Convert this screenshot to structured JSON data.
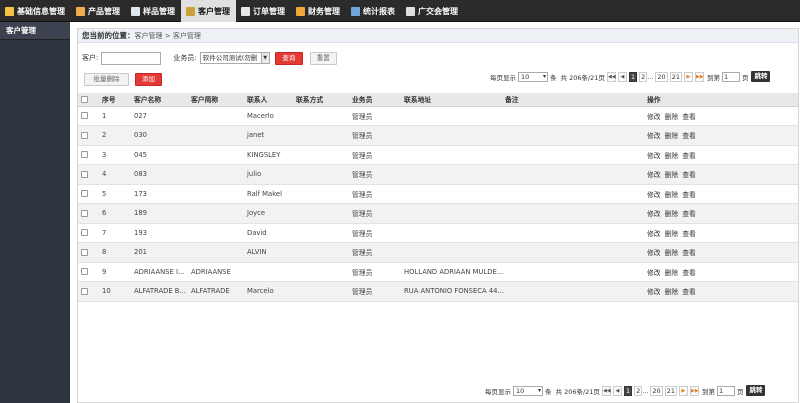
{
  "nav": {
    "items": [
      {
        "label": "基础信息管理",
        "icon": "notebook-icon",
        "color": "#f5c242",
        "active": false
      },
      {
        "label": "产品管理",
        "icon": "box-icon",
        "color": "#f0ad4e",
        "active": false
      },
      {
        "label": "样品管理",
        "icon": "document-icon",
        "color": "#dfe6ee",
        "active": false
      },
      {
        "label": "客户管理",
        "icon": "users-icon",
        "color": "#c9a23a",
        "active": true
      },
      {
        "label": "订单管理",
        "icon": "cart-icon",
        "color": "#e8e8e8",
        "active": false
      },
      {
        "label": "财务管理",
        "icon": "wallet-icon",
        "color": "#f3a63c",
        "active": false
      },
      {
        "label": "统计报表",
        "icon": "bar-chart-icon",
        "color": "#6fa8dc",
        "active": false
      },
      {
        "label": "广交会管理",
        "icon": "page-icon",
        "color": "#e0e0e0",
        "active": false
      }
    ]
  },
  "sidebar": {
    "items": [
      {
        "label": "客户管理"
      }
    ]
  },
  "breadcrumb": {
    "prefix": "您当前的位置：",
    "path": "客户管理 > 客户管理"
  },
  "filter": {
    "customer_label": "客户:",
    "customer_value": "",
    "salesman_label": "业务员:",
    "salesman_value": "软件公司测试(勿删",
    "query_label": "查询",
    "reset_label": "重置"
  },
  "actions": {
    "batch_delete": "批量删除",
    "add": "添加"
  },
  "pager": {
    "per_page_label": "每页显示",
    "per_page_value": "10",
    "unit": "条",
    "total": "共 206条/21页",
    "pages": [
      "1",
      "2",
      "...",
      "20",
      "21"
    ],
    "goto_label": "到第",
    "goto_value": "1",
    "page_unit": "页",
    "go_label": "跳转"
  },
  "table": {
    "headers": [
      "序号",
      "客户名称",
      "客户简称",
      "联系人",
      "联系方式",
      "业务员",
      "联系地址",
      "备注",
      "操作"
    ],
    "ops": [
      "修改",
      "删除",
      "查看"
    ],
    "rows": [
      {
        "no": "1",
        "name": "027",
        "short": "",
        "contact": "Macerlo",
        "phone": "",
        "sales": "管理员",
        "addr": "",
        "note": ""
      },
      {
        "no": "2",
        "name": "030",
        "short": "",
        "contact": "janet",
        "phone": "",
        "sales": "管理员",
        "addr": "",
        "note": ""
      },
      {
        "no": "3",
        "name": "045",
        "short": "",
        "contact": "KINGSLEY",
        "phone": "",
        "sales": "管理员",
        "addr": "",
        "note": ""
      },
      {
        "no": "4",
        "name": "083",
        "short": "",
        "contact": "julio",
        "phone": "",
        "sales": "管理员",
        "addr": "",
        "note": ""
      },
      {
        "no": "5",
        "name": "173",
        "short": "",
        "contact": "Ralf Makel",
        "phone": "",
        "sales": "管理员",
        "addr": "",
        "note": ""
      },
      {
        "no": "6",
        "name": "189",
        "short": "",
        "contact": "Joyce",
        "phone": "",
        "sales": "管理员",
        "addr": "",
        "note": ""
      },
      {
        "no": "7",
        "name": "193",
        "short": "",
        "contact": "David",
        "phone": "",
        "sales": "管理员",
        "addr": "",
        "note": ""
      },
      {
        "no": "8",
        "name": "201",
        "short": "",
        "contact": "ALVIN",
        "phone": "",
        "sales": "管理员",
        "addr": "",
        "note": ""
      },
      {
        "no": "9",
        "name": "ADRIAANSE I...",
        "short": "ADRIAANSE",
        "contact": "",
        "phone": "",
        "sales": "管理员",
        "addr": "HOLLAND ADRIAAN MULDE...",
        "note": ""
      },
      {
        "no": "10",
        "name": "ALFATRADE B...",
        "short": "ALFATRADE",
        "contact": "Marcelo",
        "phone": "",
        "sales": "管理员",
        "addr": "RUA ANTONIO FONSECA 44...",
        "note": ""
      }
    ]
  }
}
